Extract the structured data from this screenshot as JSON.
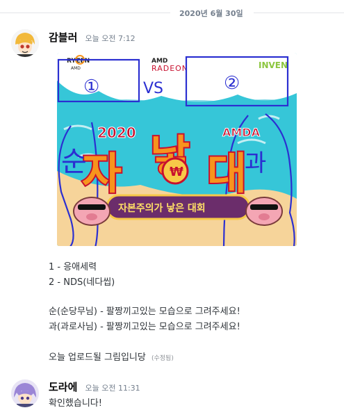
{
  "date_divider": "2020년 6월 30일",
  "messages": [
    {
      "author": "감블러",
      "timestamp": "오늘 오전 7:12",
      "image": {
        "sponsor_ryzen": "RYZEN",
        "sponsor_ryzen_sub": "AMD",
        "sponsor_radeon_brand": "AMD",
        "sponsor_radeon": "RADEON",
        "sponsor_inven": "INVEN",
        "vs": "VS",
        "circle_1": "①",
        "circle_2": "②",
        "year": "2020",
        "brand": "AMDA",
        "title_chars": [
          "자",
          "낳",
          "대"
        ],
        "subtitle": "자본주의가 낳은 대회",
        "handwrite_left": "순",
        "handwrite_right": "과"
      },
      "lines": [
        "1 - 응애세력",
        "2 - NDS(네다씹)",
        "",
        "순(순당무님) - 팔짱끼고있는 모습으로 그려주세요!",
        "과(과로사님) - 팔짱끼고있는 모습으로 그려주세요!",
        "",
        "오늘 업로드될 그림입니당"
      ],
      "edited_label": "(수정됨)"
    },
    {
      "author": "도라에",
      "timestamp": "오늘 오전 11:31",
      "lines": [
        "확인했습니다!"
      ]
    }
  ],
  "colors": {
    "username": "#060607",
    "timestamp": "#747f8d",
    "text": "#2e3338",
    "banner_red": "#c8102e",
    "banner_orange": "#f7941d",
    "pen_blue": "#2b2fd1",
    "water": "#36c6d8"
  }
}
